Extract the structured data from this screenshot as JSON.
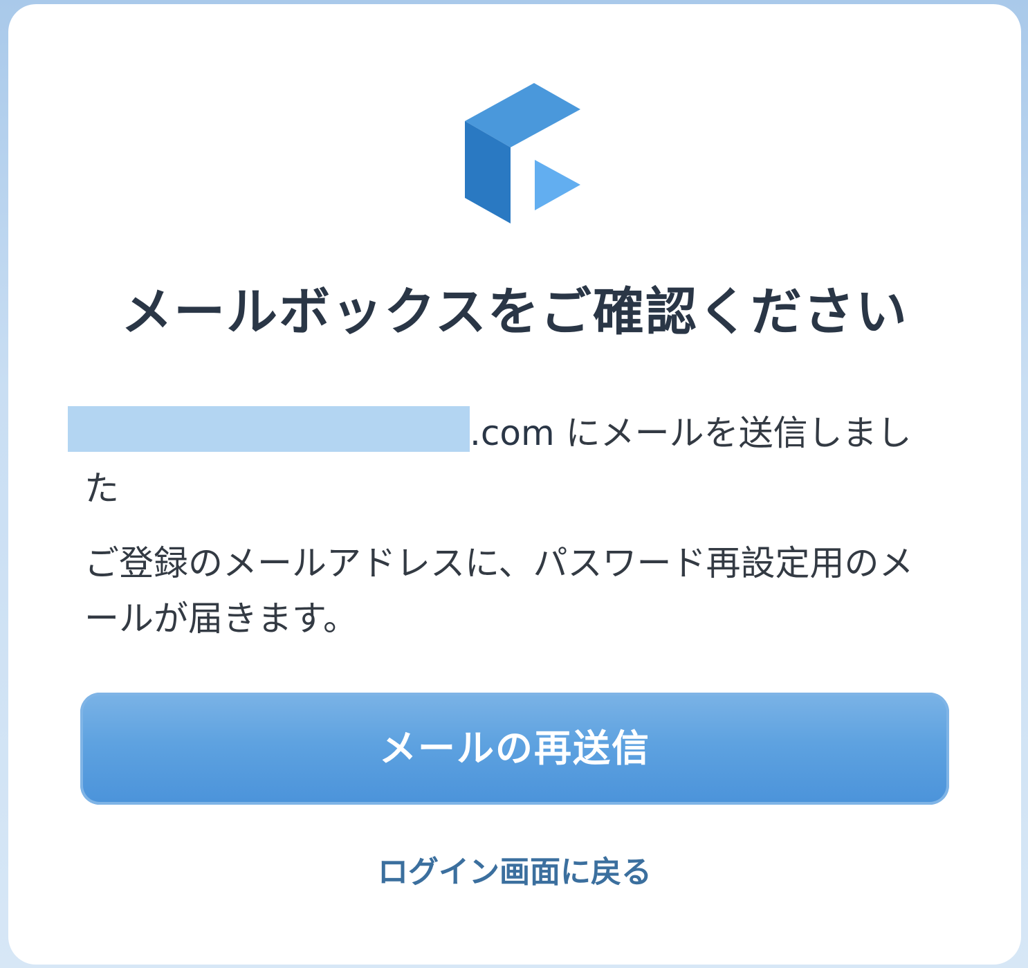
{
  "dialog": {
    "title": "メールボックスをご確認ください",
    "sent_email_domain": ".com",
    "sent_message_suffix": " にメールを送信しました",
    "info_message": "ご登録のメールアドレスに、パスワード再設定用のメールが届きます。",
    "resend_button_label": "メールの再送信",
    "back_to_login_label": "ログイン画面に戻る"
  },
  "colors": {
    "accent": "#4b93da",
    "logo_dark": "#2a79c2",
    "logo_mid": "#4a98db",
    "logo_light": "#62aef0",
    "link": "#3b6f9e",
    "title": "#2a3646",
    "email_mask": "#b3d5f2"
  },
  "icons": {
    "logo": "app-logo-icon"
  }
}
